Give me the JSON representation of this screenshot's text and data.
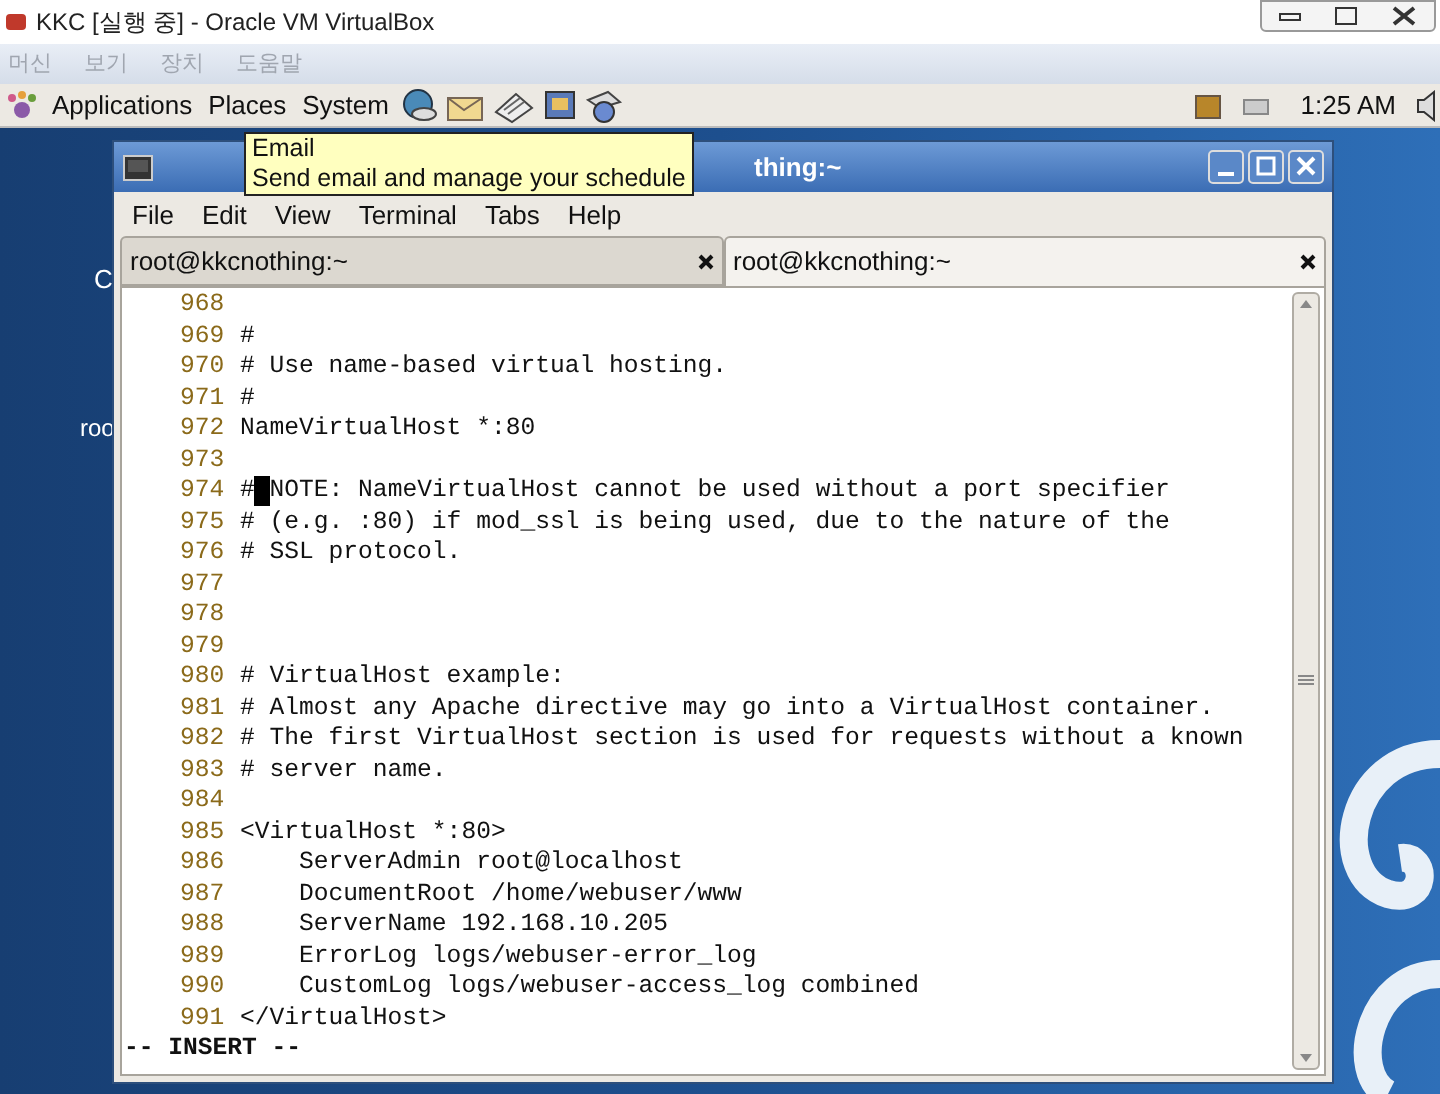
{
  "host_window": {
    "title": "KKC [실행 중] - Oracle VM VirtualBox"
  },
  "host_menu": [
    {
      "label": "머신",
      "disabled": true
    },
    {
      "label": "보기",
      "disabled": true
    },
    {
      "label": "장치",
      "disabled": true
    },
    {
      "label": "도움말",
      "disabled": true
    }
  ],
  "panel": {
    "menus": [
      "Applications",
      "Places",
      "System"
    ],
    "clock": "1:25 AM"
  },
  "tooltip": {
    "title": "Email",
    "description": "Send email and manage your schedule"
  },
  "desktop_icons": [
    "C",
    "roo"
  ],
  "terminal": {
    "title": "thing:~",
    "menu": [
      "File",
      "Edit",
      "View",
      "Terminal",
      "Tabs",
      "Help"
    ],
    "tabs": [
      {
        "label": "root@kkcnothing:~",
        "selected": false
      },
      {
        "label": "root@kkcnothing:~",
        "selected": true
      }
    ],
    "lines": [
      {
        "number": "968"
      },
      {
        "number": "969",
        "text": "#"
      },
      {
        "number": "970",
        "text": "# Use name-based virtual hosting."
      },
      {
        "number": "971",
        "text": "#"
      },
      {
        "number": "972",
        "text": "NameVirtualHost *:80"
      },
      {
        "number": "973"
      },
      {
        "number": "974",
        "text": "#",
        "cursor": true,
        "text_after": "NOTE: NameVirtualHost cannot be used without a port specifier"
      },
      {
        "number": "975",
        "text": "# (e.g. :80) if mod_ssl is being used, due to the nature of the"
      },
      {
        "number": "976",
        "text": "# SSL protocol."
      },
      {
        "number": "977"
      },
      {
        "number": "978"
      },
      {
        "number": "979"
      },
      {
        "number": "980",
        "text": "# VirtualHost example:"
      },
      {
        "number": "981",
        "text": "# Almost any Apache directive may go into a VirtualHost container."
      },
      {
        "number": "982",
        "text": "# The first VirtualHost section is used for requests without a known"
      },
      {
        "number": "983",
        "text": "# server name."
      },
      {
        "number": "984"
      },
      {
        "number": "985",
        "text": "<VirtualHost *:80>"
      },
      {
        "number": "986",
        "text": "    ServerAdmin root@localhost"
      },
      {
        "number": "987",
        "text": "    DocumentRoot /home/webuser/www"
      },
      {
        "number": "988",
        "text": "    ServerName 192.168.10.205"
      },
      {
        "number": "989",
        "text": "    ErrorLog logs/webuser-error_log"
      },
      {
        "number": "990",
        "text": "    CustomLog logs/webuser-access_log combined"
      },
      {
        "number": "991",
        "text": "</VirtualHost>"
      }
    ],
    "status": "-- INSERT --"
  }
}
